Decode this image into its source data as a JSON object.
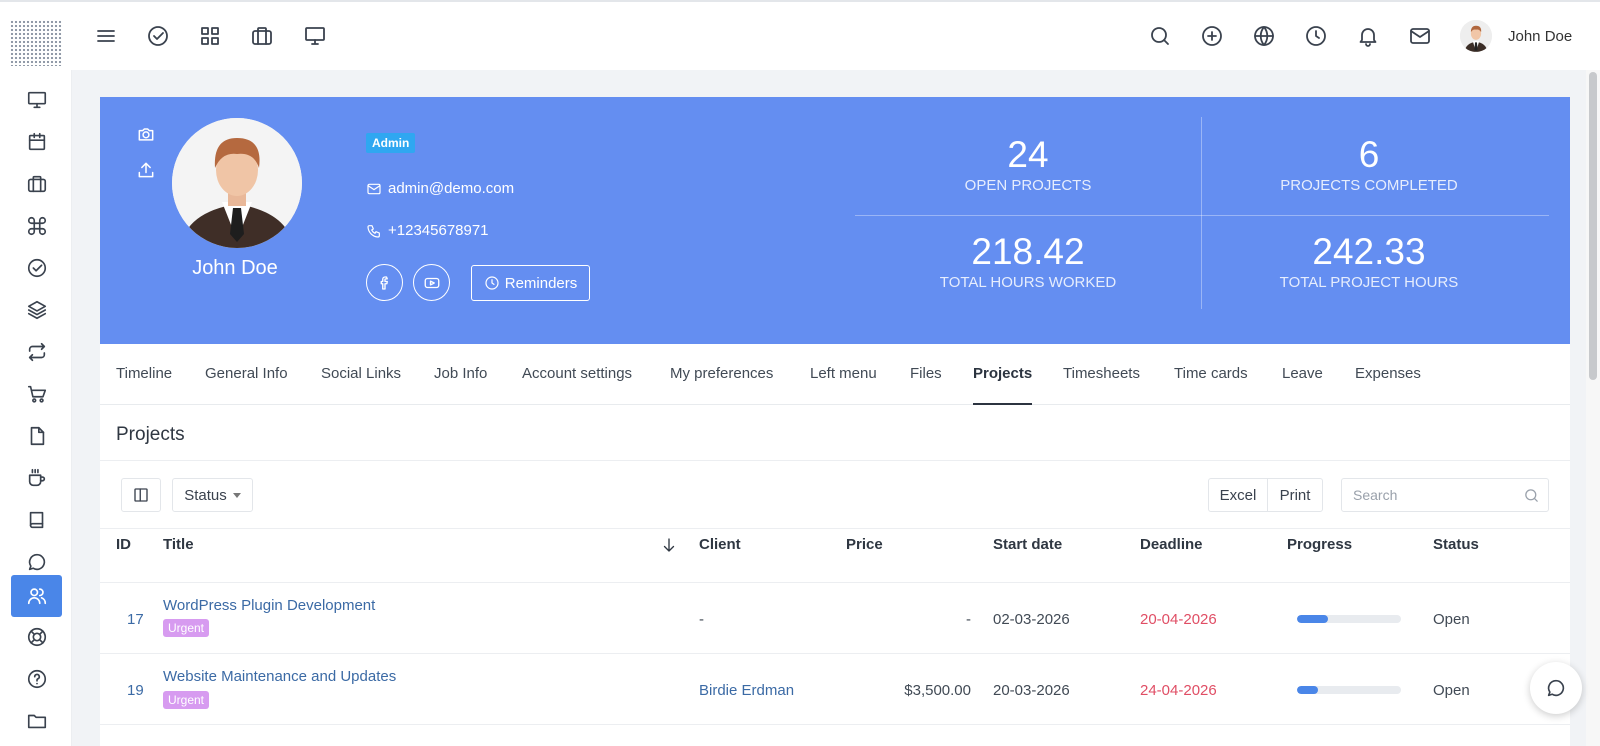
{
  "topbar": {
    "icons": [
      "menu-icon",
      "check-circle-icon",
      "grid-icon",
      "briefcase-icon",
      "monitor-icon"
    ],
    "right_icons": [
      "search-icon",
      "plus-circle-icon",
      "globe-icon",
      "clock-icon",
      "bell-icon",
      "mail-icon"
    ],
    "user_name": "John Doe"
  },
  "sidebar": {
    "items": [
      {
        "icon": "monitor-icon"
      },
      {
        "icon": "calendar-icon"
      },
      {
        "icon": "briefcase-icon"
      },
      {
        "icon": "command-icon"
      },
      {
        "icon": "check-circle-icon"
      },
      {
        "icon": "layers-icon"
      },
      {
        "icon": "repeat-icon"
      },
      {
        "icon": "cart-icon"
      },
      {
        "icon": "file-icon"
      },
      {
        "icon": "coffee-icon"
      },
      {
        "icon": "book-icon"
      },
      {
        "icon": "chat-icon"
      },
      {
        "icon": "users-icon",
        "active": true
      },
      {
        "icon": "lifebuoy-icon"
      },
      {
        "icon": "help-circle-icon"
      },
      {
        "icon": "folder-icon"
      }
    ]
  },
  "profile": {
    "name": "John Doe",
    "role_badge": "Admin",
    "email": "admin@demo.com",
    "phone": "+12345678971",
    "reminders_label": "Reminders",
    "banner_color": "#648ef1"
  },
  "stats": {
    "open_projects": {
      "value": "24",
      "label": "OPEN PROJECTS"
    },
    "projects_completed": {
      "value": "6",
      "label": "PROJECTS COMPLETED"
    },
    "total_hours_worked": {
      "value": "218.42",
      "label": "TOTAL HOURS WORKED"
    },
    "total_project_hours": {
      "value": "242.33",
      "label": "TOTAL PROJECT HOURS"
    }
  },
  "tabs": [
    "Timeline",
    "General Info",
    "Social Links",
    "Job Info",
    "Account settings",
    "My preferences",
    "Left menu",
    "Files",
    "Projects",
    "Timesheets",
    "Time cards",
    "Leave",
    "Expenses"
  ],
  "active_tab": "Projects",
  "projects": {
    "title": "Projects",
    "status_filter": "Status",
    "excel_label": "Excel",
    "print_label": "Print",
    "search_placeholder": "Search",
    "columns": {
      "id": "ID",
      "title": "Title",
      "client": "Client",
      "price": "Price",
      "start_date": "Start date",
      "deadline": "Deadline",
      "progress": "Progress",
      "status": "Status"
    },
    "rows": [
      {
        "id": "17",
        "title": "WordPress Plugin Development",
        "tag": "Urgent",
        "client": "-",
        "price": "-",
        "start_date": "02-03-2026",
        "deadline": "20-04-2026",
        "progress": 0.3,
        "status": "Open"
      },
      {
        "id": "19",
        "title": "Website Maintenance and Updates",
        "tag": "Urgent",
        "client": "Birdie Erdman",
        "price": "$3,500.00",
        "start_date": "20-03-2026",
        "deadline": "24-04-2026",
        "progress": 0.2,
        "status": "Open"
      }
    ]
  },
  "colors": {
    "accent": "#4a86e8",
    "deadline": "#e04e65",
    "urgent_tag": "#d79bf0",
    "admin_badge": "#2fa7f1"
  }
}
